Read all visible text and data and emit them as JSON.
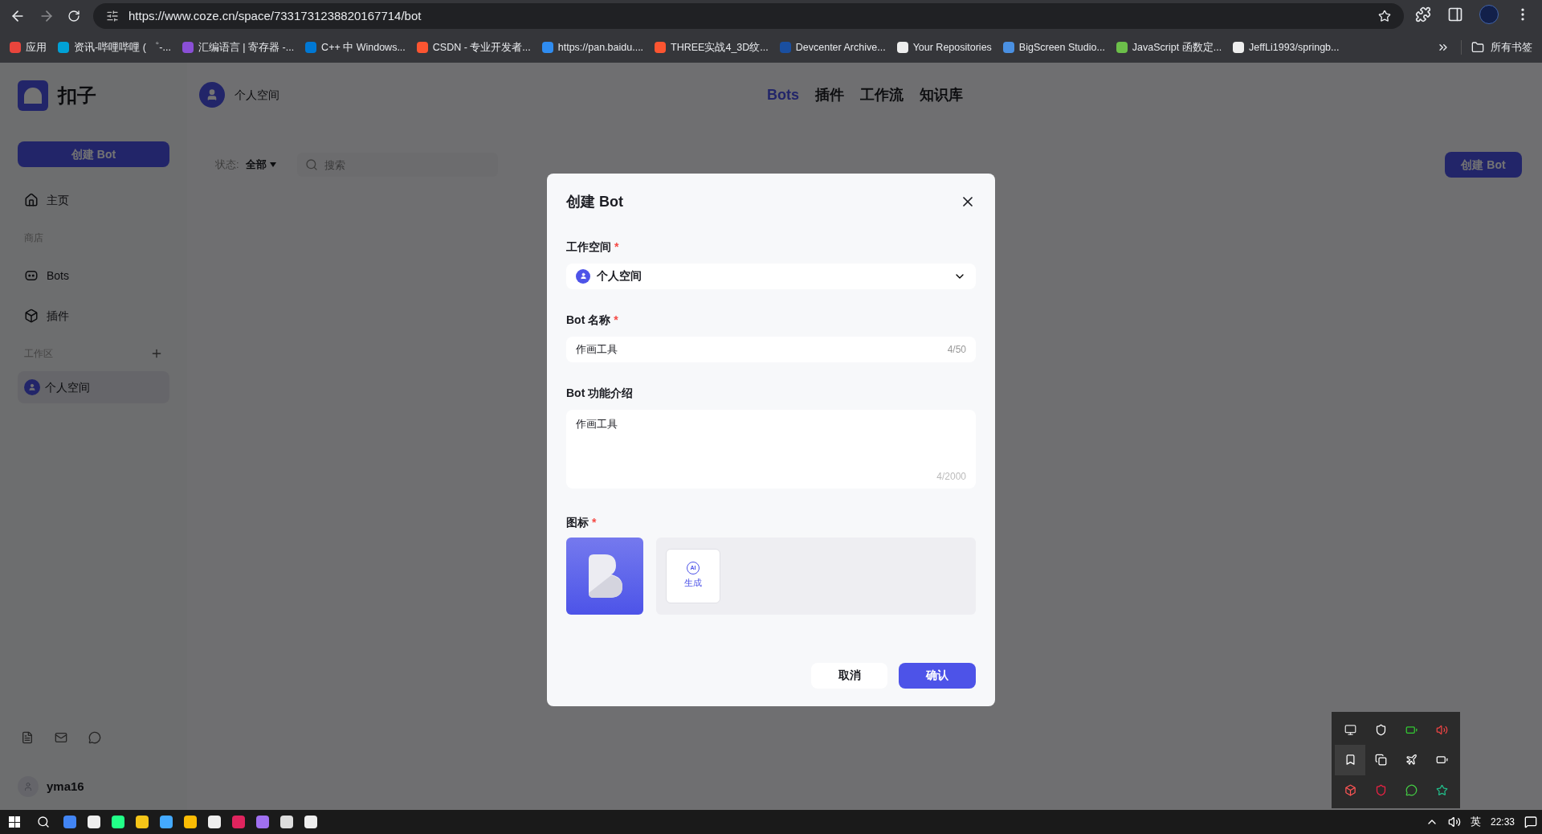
{
  "browser": {
    "url": "https://www.coze.cn/space/7331731238820167714/bot",
    "bookmarks": [
      "应用",
      "资讯-哔哩哔哩 ( ゜-...",
      "汇编语言 | 寄存器 -...",
      "C++ 中 Windows...",
      "CSDN - 专业开发者...",
      "https://pan.baidu....",
      "THREE实战4_3D纹...",
      "Devcenter Archive...",
      "Your Repositories",
      "BigScreen Studio...",
      "JavaScript 函数定...",
      "JeffLi1993/springb..."
    ],
    "all_bookmarks": "所有书签"
  },
  "sidebar": {
    "logo_text": "扣子",
    "create_button": "创建 Bot",
    "items": [
      {
        "kind": "nav",
        "label": "主页",
        "selected": false
      },
      {
        "kind": "section",
        "label": "商店",
        "addable": false
      },
      {
        "kind": "nav",
        "label": "Bots",
        "selected": false
      },
      {
        "kind": "nav",
        "label": "插件",
        "selected": false
      },
      {
        "kind": "section",
        "label": "工作区",
        "addable": true
      },
      {
        "kind": "space",
        "label": "个人空间",
        "selected": true
      }
    ],
    "user": "yma16"
  },
  "header": {
    "space": "个人空间",
    "tabs": [
      {
        "label": "Bots",
        "selected": true
      },
      {
        "label": "插件",
        "selected": false
      },
      {
        "label": "工作流",
        "selected": false
      },
      {
        "label": "知识库",
        "selected": false
      }
    ]
  },
  "toolbar": {
    "status_label": "状态:",
    "status_value": "全部",
    "search_placeholder": "搜索",
    "create_button": "创建 Bot"
  },
  "dialog": {
    "title": "创建 Bot",
    "required_mark": "*",
    "fields": [
      {
        "kind": "select",
        "label": "工作空间",
        "required": true,
        "value": "个人空间"
      },
      {
        "kind": "input",
        "label": "Bot 名称",
        "required": true,
        "value": "作画工具",
        "count": "4/50"
      },
      {
        "kind": "textarea",
        "label": "Bot 功能介绍",
        "required": false,
        "value": "作画工具",
        "count": "4/2000"
      }
    ],
    "icon_label": "图标",
    "icon_required": true,
    "generate_badge": "AI",
    "generate_label": "生成",
    "cancel": "取消",
    "confirm": "确认"
  },
  "taskbar": {
    "language": "英",
    "time": "22:33"
  }
}
